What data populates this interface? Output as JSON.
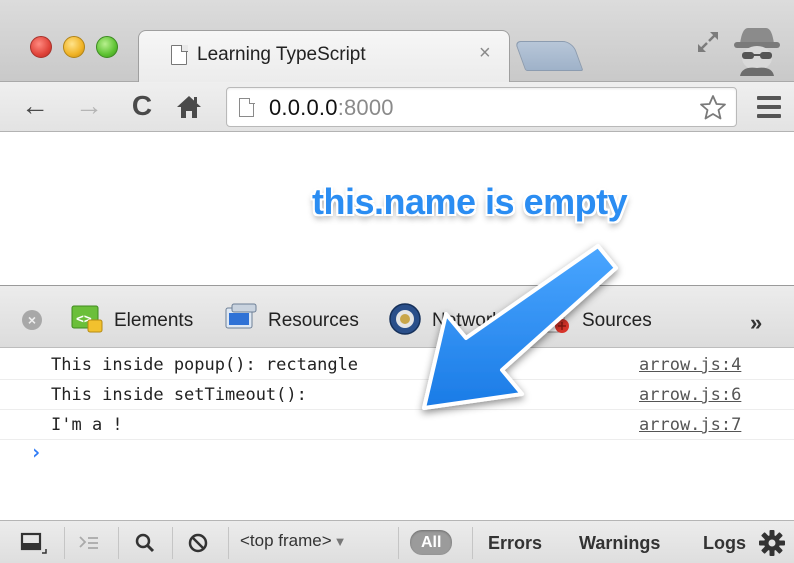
{
  "tab": {
    "title": "Learning TypeScript",
    "close_glyph": "×"
  },
  "toolbar": {
    "back_glyph": "←",
    "forward_glyph": "→",
    "reload_glyph": "C",
    "home_glyph": "⌂",
    "url_host": "0.0.0.0",
    "url_port": ":8000"
  },
  "annotation": {
    "text": "this.name is empty",
    "color": "#2b8df2"
  },
  "devtools": {
    "tabs": [
      {
        "label": "Elements",
        "icon": "elements-icon"
      },
      {
        "label": "Resources",
        "icon": "resources-icon"
      },
      {
        "label": "Network",
        "icon": "network-icon"
      },
      {
        "label": "Sources",
        "icon": "sources-icon"
      }
    ],
    "more_glyph": "»",
    "console": {
      "rows": [
        {
          "message": "This inside popup(): rectangle",
          "source": "arrow.js:4"
        },
        {
          "message": "This inside setTimeout():",
          "source": "arrow.js:6"
        },
        {
          "message": "I'm a !",
          "source": "arrow.js:7"
        }
      ],
      "prompt": "›"
    },
    "status_bar": {
      "frame_select": "<top frame>",
      "frame_arrow": "▼",
      "filters": [
        "All",
        "Errors",
        "Warnings",
        "Logs"
      ]
    }
  }
}
